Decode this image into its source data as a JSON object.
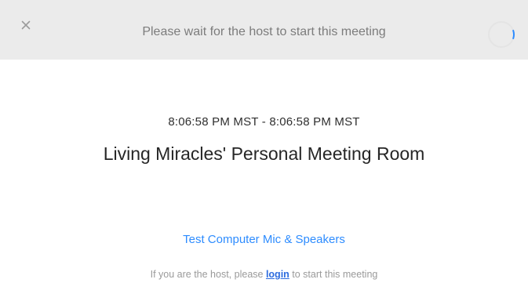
{
  "header": {
    "close_icon": "close-icon",
    "title": "Please wait for the host to start this meeting",
    "spinner_icon": "loading-spinner-icon"
  },
  "meeting": {
    "time_range": "8:06:58 PM MST - 8:06:58 PM MST",
    "title": "Living Miracles' Personal Meeting Room"
  },
  "actions": {
    "test_audio_label": "Test Computer Mic & Speakers"
  },
  "host_note": {
    "prefix": "If you are the host, please ",
    "login_label": "login",
    "suffix": " to start this meeting"
  },
  "colors": {
    "header_bg": "#ebebeb",
    "accent_link": "#2d8cff",
    "login_link": "#2d6cdf",
    "muted_text": "#9a9a9a"
  }
}
